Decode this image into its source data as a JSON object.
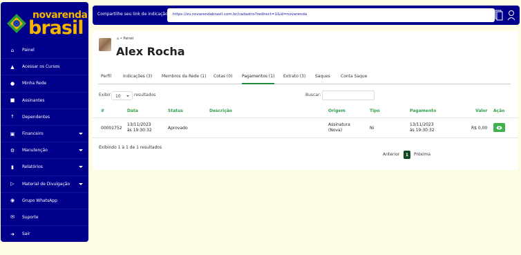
{
  "logo": {
    "top": "novarenda",
    "bottom": "brasil"
  },
  "sidebar": {
    "items": [
      {
        "label": "Painel",
        "icon": "home-icon"
      },
      {
        "label": "Acessar os Cursos",
        "icon": "graduation-cap-icon"
      },
      {
        "label": "Minha Rede",
        "icon": "network-icon"
      },
      {
        "label": "Assinantes",
        "icon": "user-icon"
      },
      {
        "label": "Dependentes",
        "icon": "person-up-icon"
      },
      {
        "label": "Financeiro",
        "icon": "money-icon",
        "dropdown": true
      },
      {
        "label": "Manutenção",
        "icon": "gear-icon",
        "dropdown": true
      },
      {
        "label": "Relatórios",
        "icon": "bar-chart-icon",
        "dropdown": true
      },
      {
        "label": "Material de Divulgação",
        "icon": "megaphone-icon",
        "dropdown": true
      },
      {
        "label": "Grupo WhatsApp",
        "icon": "chat-icon"
      },
      {
        "label": "Suporte",
        "icon": "envelope-icon"
      },
      {
        "label": "Sair",
        "icon": "sign-out-icon"
      }
    ]
  },
  "topbar": {
    "share_label": "Compartilhe seu link de indicação:",
    "share_link": "https://ev.novarendabrasil.com.br/cadastro?redirect=1&id=novarenda"
  },
  "page": {
    "breadcrumb": "Painel",
    "title": "Alex Rocha"
  },
  "tabs": [
    {
      "label": "Perfil",
      "active": false
    },
    {
      "label": "Indicações (3)",
      "active": false
    },
    {
      "label": "Membros da Rede (1)",
      "active": false
    },
    {
      "label": "Cotas (0)",
      "active": false
    },
    {
      "label": "Pagamentos (1)",
      "active": true
    },
    {
      "label": "Extrato (3)",
      "active": false
    },
    {
      "label": "Saques",
      "active": false
    },
    {
      "label": "Conta Saque",
      "active": false
    }
  ],
  "table_controls": {
    "show_label": "Exibir",
    "page_size": "10",
    "after_label": "resultados",
    "search_label": "Buscar:",
    "search_value": ""
  },
  "table": {
    "columns": [
      "#",
      "Data",
      "Status",
      "Descrição",
      "Origem",
      "Tipo",
      "Pagamento",
      "Valor",
      "Ação"
    ],
    "rows": [
      {
        "id": "00001752",
        "date_line1": "13/11/2023",
        "date_line2": "às 19:30:32",
        "status": "Aprovado",
        "description": "",
        "origin_line1": "Assinatura",
        "origin_line2": "(Nova)",
        "type": "Ni",
        "payment_line1": "13/11/2023",
        "payment_line2": "às 19:30:32",
        "value": "R$ 0,00",
        "action_icon": "eye-icon"
      }
    ]
  },
  "footer": {
    "info": "Exibindo 1 à 1 de 1 resultados",
    "prev": "Anterior",
    "page": "1",
    "next": "Próxima"
  },
  "colors": {
    "navy": "#00008b",
    "gold": "#f5b400",
    "green": "#2e9e4a",
    "background": "#fdfbe3"
  }
}
